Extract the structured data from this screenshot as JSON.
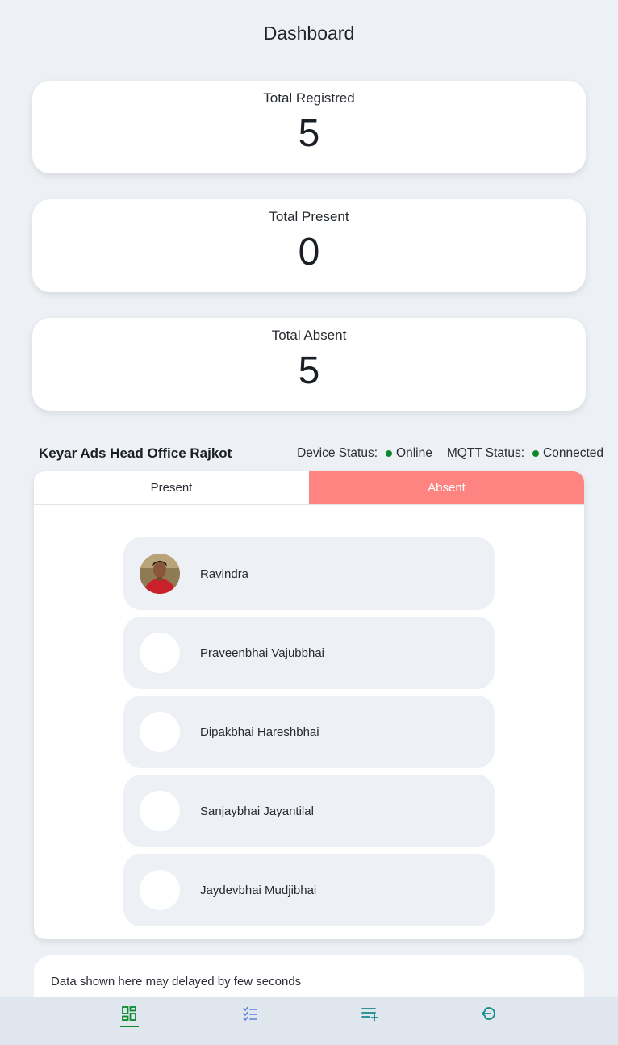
{
  "page": {
    "title": "Dashboard"
  },
  "stats": [
    {
      "label": "Total Registred",
      "value": "5"
    },
    {
      "label": "Total Present",
      "value": "0"
    },
    {
      "label": "Total Absent",
      "value": "5"
    }
  ],
  "office": {
    "name": "Keyar Ads Head Office Rajkot",
    "device_status_label": "Device Status:",
    "device_status_value": "Online",
    "mqtt_status_label": "MQTT Status:",
    "mqtt_status_value": "Connected",
    "status_color": "#0e8a2a"
  },
  "tabs": {
    "present_label": "Present",
    "absent_label": "Absent",
    "selected": "Absent",
    "selected_color": "#fd8481"
  },
  "people": [
    {
      "name": "Ravindra",
      "avatar": "photo"
    },
    {
      "name": "Praveenbhai Vajubbhai",
      "avatar": "blank"
    },
    {
      "name": "Dipakbhai Hareshbhai",
      "avatar": "blank"
    },
    {
      "name": "Sanjaybhai Jayantilal",
      "avatar": "blank"
    },
    {
      "name": "Jaydevbhai Mudjibhai",
      "avatar": "blank"
    }
  ],
  "notice": {
    "text": "Data shown here may delayed by few seconds"
  },
  "nav": {
    "items": [
      {
        "icon": "dashboard-icon",
        "active": true
      },
      {
        "icon": "checklist-icon",
        "active": false
      },
      {
        "icon": "playlist-add-icon",
        "active": false
      },
      {
        "icon": "logout-icon",
        "active": false
      }
    ],
    "active_color": "#0b8a2e",
    "icon_color": "#138a8a"
  }
}
